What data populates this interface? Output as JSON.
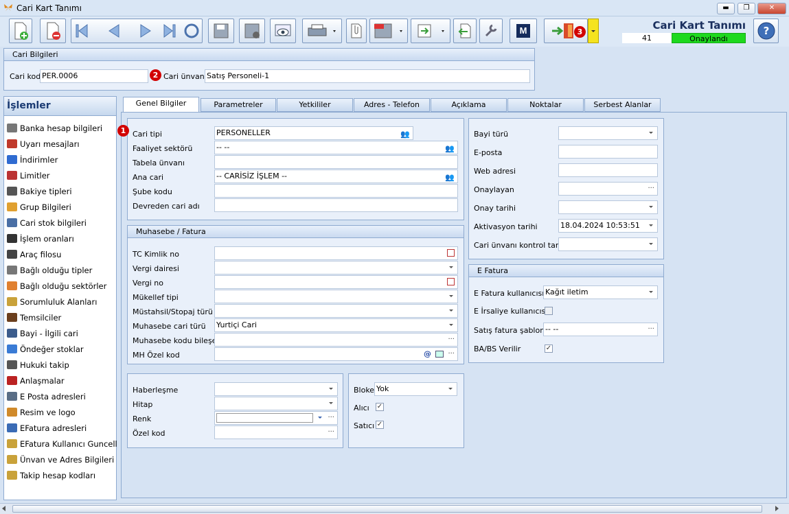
{
  "window": {
    "title": "Cari Kart Tanımı",
    "min": "▬",
    "max": "❐",
    "close": "✕"
  },
  "toolbar": {
    "form_title": "Cari Kart Tanımı",
    "record_no": "41",
    "status": "Onaylandı",
    "badge3": "3",
    "m_label": "M"
  },
  "header": {
    "section_title": "Cari Bilgileri",
    "cari_kod_label": "Cari kod",
    "cari_kod_value": "PER.0006",
    "cari_unvani_label": "Cari ünvanı",
    "cari_unvani_value": "Satış Personeli-1",
    "badge2": "2"
  },
  "sidebar": {
    "title": "İşlemler",
    "items": [
      {
        "label": "Banka hesap bilgileri",
        "icon": "bank-icon",
        "color": "#777"
      },
      {
        "label": "Uyarı mesajları",
        "icon": "warning-icon",
        "color": "#c0392b"
      },
      {
        "label": "İndirimler",
        "icon": "discount-icon",
        "color": "#2f6bd1"
      },
      {
        "label": "Limitler",
        "icon": "limit-icon",
        "color": "#b33"
      },
      {
        "label": "Bakiye tipleri",
        "icon": "balance-icon",
        "color": "#555"
      },
      {
        "label": "Grup Bilgileri",
        "icon": "group-icon",
        "color": "#e0a030"
      },
      {
        "label": "Cari stok bilgileri",
        "icon": "stock-icon",
        "color": "#4a6fa5"
      },
      {
        "label": "İşlem oranları",
        "icon": "percent-icon",
        "color": "#333"
      },
      {
        "label": "Araç filosu",
        "icon": "vehicle-icon",
        "color": "#444"
      },
      {
        "label": "Bağlı olduğu tipler",
        "icon": "types-icon",
        "color": "#777"
      },
      {
        "label": "Bağlı olduğu sektörler",
        "icon": "sectors-icon",
        "color": "#e08030"
      },
      {
        "label": "Sorumluluk Alanları",
        "icon": "responsibility-icon",
        "color": "#c9a23a"
      },
      {
        "label": "Temsilciler",
        "icon": "representative-icon",
        "color": "#6b3f1d"
      },
      {
        "label": "Bayi - İlgili cari",
        "icon": "dealer-icon",
        "color": "#3c5c8c"
      },
      {
        "label": "Öndeğer stoklar",
        "icon": "default-stock-icon",
        "color": "#3a7bd5"
      },
      {
        "label": "Hukuki takip",
        "icon": "legal-icon",
        "color": "#555"
      },
      {
        "label": "Anlaşmalar",
        "icon": "agreement-icon",
        "color": "#b22"
      },
      {
        "label": "E Posta adresleri",
        "icon": "mail-icon",
        "color": "#5a6d85"
      },
      {
        "label": "Resim ve logo",
        "icon": "image-icon",
        "color": "#d08a2a"
      },
      {
        "label": "EFatura adresleri",
        "icon": "efatura-icon",
        "color": "#3a6bb5"
      },
      {
        "label": "EFatura Kullanıcı Guncelle",
        "icon": "efatura-user-icon",
        "color": "#c9a23a"
      },
      {
        "label": "Ünvan ve Adres Bilgileri ...",
        "icon": "address-icon",
        "color": "#c9a23a"
      },
      {
        "label": "Takip hesap kodları",
        "icon": "tracking-icon",
        "color": "#c9a23a"
      }
    ]
  },
  "tabs": [
    "Genel Bilgiler",
    "Parametreler",
    "Yetkililer",
    "Adres - Telefon",
    "Açıklama",
    "Noktalar",
    "Serbest Alanlar"
  ],
  "genel": {
    "badge1": "1",
    "cari_tipi_label": "Cari tipi",
    "cari_tipi_value": "PERSONELLER",
    "faaliyet_label": "Faaliyet sektörü",
    "faaliyet_value": "-- --",
    "tabela_label": "Tabela ünvanı",
    "tabela_value": "",
    "ana_cari_label": "Ana cari",
    "ana_cari_value": "-- CARİSİZ İŞLEM --",
    "sube_label": "Şube kodu",
    "sube_value": "",
    "devreden_label": "Devreden cari adı",
    "devreden_value": ""
  },
  "muhasebe": {
    "title": "Muhasebe / Fatura",
    "tc_label": "TC Kimlik no",
    "vergi_dairesi_label": "Vergi dairesi",
    "vergi_no_label": "Vergi no",
    "mukellef_label": "Mükellef tipi",
    "mustahsil_label": "Müstahsil/Stopaj türü",
    "muh_cari_turu_label": "Muhasebe cari türü",
    "muh_cari_turu_value": "Yurtiçi Cari",
    "muh_kodu_label": "Muhasebe kodu bileşeni",
    "mh_ozel_label": "MH Özel kod",
    "at_sign": "@"
  },
  "haber": {
    "haberlesme_label": "Haberleşme",
    "hitap_label": "Hitap",
    "renk_label": "Renk",
    "ozel_kod_label": "Özel kod"
  },
  "bloke": {
    "bloke_label": "Bloke",
    "bloke_value": "Yok",
    "alici_label": "Alıcı",
    "alici_checked": "✓",
    "satici_label": "Satıcı",
    "satici_checked": "✓"
  },
  "right": {
    "bayi_turu_label": "Bayi türü",
    "eposta_label": "E-posta",
    "web_label": "Web adresi",
    "onaylayan_label": "Onaylayan",
    "onay_tarihi_label": "Onay tarihi",
    "aktivasyon_label": "Aktivasyon tarihi",
    "aktivasyon_value": "18.04.2024 10:53:51",
    "kontrol_label": "Cari ünvanı kontrol tarihi"
  },
  "efatura": {
    "title": "E Fatura",
    "kullanici_label": "E Fatura kullanıcısı",
    "kullanici_value": "Kağıt iletim",
    "irsaliye_label": "E İrsaliye kullanıcısı",
    "irsaliye_checked": "",
    "sablon_label": "Satış fatura şablonu",
    "sablon_value": "-- --",
    "babs_label": "BA/BS Verilir",
    "babs_checked": "✓"
  },
  "dots": "···"
}
